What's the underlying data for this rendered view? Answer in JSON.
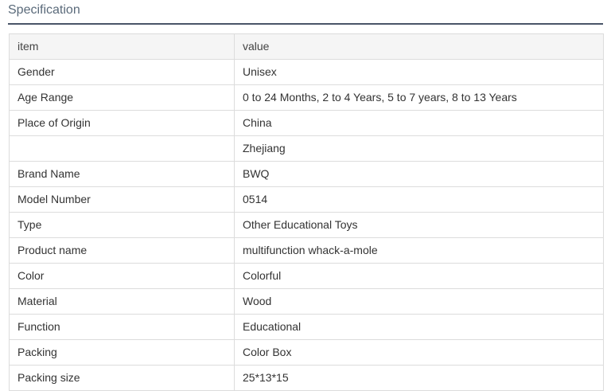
{
  "section": {
    "title": "Specification"
  },
  "table": {
    "header": {
      "key": "item",
      "value": "value"
    },
    "rows": [
      {
        "key": "Gender",
        "value": "Unisex"
      },
      {
        "key": "Age Range",
        "value": "0 to 24 Months, 2 to 4 Years, 5 to 7 years, 8 to 13 Years"
      },
      {
        "key": "Place of Origin",
        "value": "China"
      },
      {
        "key": "",
        "value": "Zhejiang"
      },
      {
        "key": "Brand Name",
        "value": "BWQ"
      },
      {
        "key": "Model Number",
        "value": "0514"
      },
      {
        "key": "Type",
        "value": "Other Educational Toys"
      },
      {
        "key": "Product name",
        "value": "multifunction whack-a-mole"
      },
      {
        "key": "Color",
        "value": "Colorful"
      },
      {
        "key": "Material",
        "value": "Wood"
      },
      {
        "key": "Function",
        "value": "Educational"
      },
      {
        "key": "Packing",
        "value": "Color Box"
      },
      {
        "key": "Packing size",
        "value": "25*13*15"
      }
    ]
  },
  "colors": {
    "header_row_bg": "#f5f5f5",
    "border": "#dcdcdc",
    "title_underline": "#4a5568"
  }
}
